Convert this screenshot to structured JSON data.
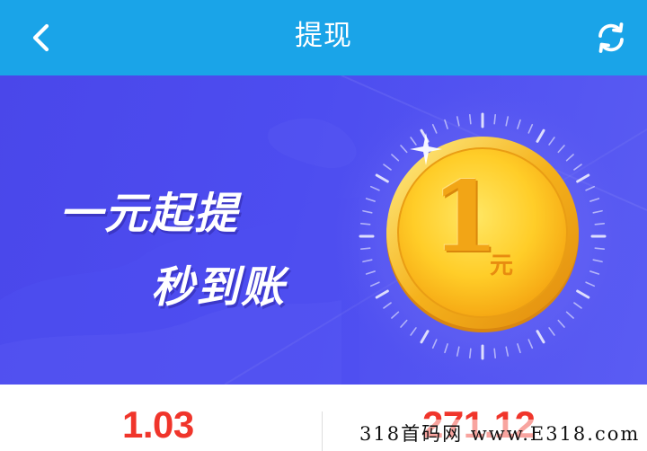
{
  "header": {
    "title": "提现",
    "back_icon": "chevron-left-icon",
    "refresh_icon": "refresh-icon",
    "background": "#1aa4e8"
  },
  "banner": {
    "slogan_line1": "一元起提",
    "slogan_line2": "秒到账",
    "coin": {
      "amount": "1",
      "unit": "元"
    },
    "background": "#4a47ea"
  },
  "stats": {
    "left_value": "1.03",
    "right_value": "271.12",
    "value_color": "#f0352b"
  },
  "watermark": "318首码网 www.E318.com"
}
